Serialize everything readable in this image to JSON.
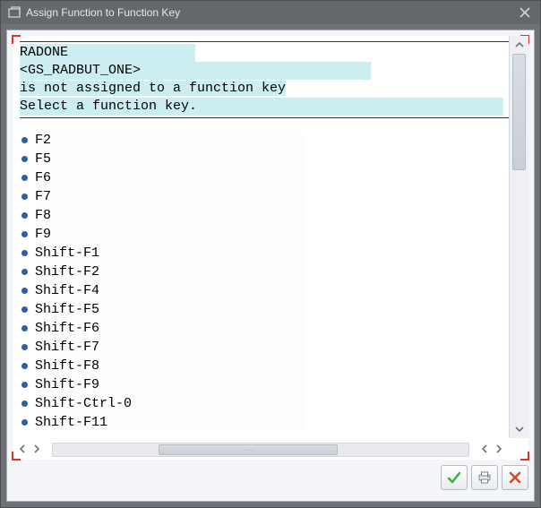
{
  "window": {
    "title": "Assign Function to Function Key"
  },
  "header": {
    "line1": "RADONE",
    "line2": "<GS_RADBUT_ONE>",
    "line3": "is not assigned to a function key",
    "line4": "Select a function key."
  },
  "list": {
    "items": [
      "F2",
      "F5",
      "F6",
      "F7",
      "F8",
      "F9",
      "Shift-F1",
      "Shift-F2",
      "Shift-F4",
      "Shift-F5",
      "Shift-F6",
      "Shift-F7",
      "Shift-F8",
      "Shift-F9",
      "Shift-Ctrl-0",
      "Shift-F11"
    ]
  },
  "buttons": {
    "confirm": "Confirm",
    "print": "Print",
    "cancel": "Cancel"
  }
}
